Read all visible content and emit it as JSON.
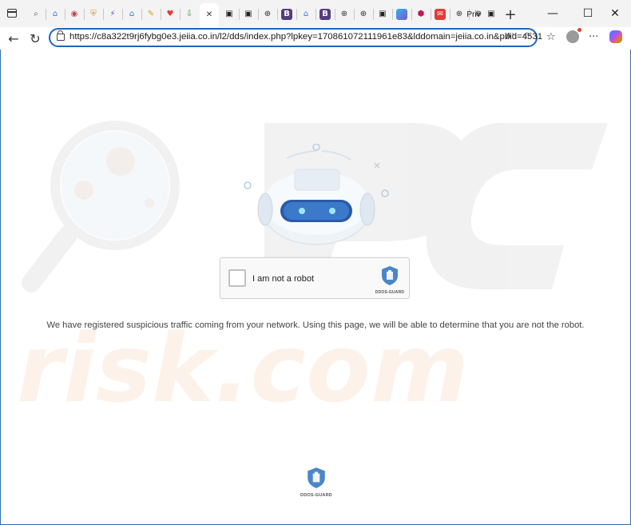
{
  "browser": {
    "tabs": [
      {
        "icon": "magnifier-icon",
        "color": "#555555",
        "active": false
      },
      {
        "icon": "house-icon",
        "color": "#3b7bd6",
        "active": false
      },
      {
        "icon": "target-icon",
        "color": "#d23b3b",
        "active": false
      },
      {
        "icon": "shield-icon",
        "color": "#c79a2a",
        "active": false
      },
      {
        "icon": "bolt-icon",
        "color": "#7b3fe4",
        "active": false
      },
      {
        "icon": "house-icon",
        "color": "#3b7bd6",
        "active": false
      },
      {
        "icon": "tag-icon",
        "color": "#d4a017",
        "active": false
      },
      {
        "icon": "heart-icon",
        "color": "#e03a3a",
        "active": false
      },
      {
        "icon": "download-icon",
        "color": "#2e9a4a",
        "active": false
      },
      {
        "icon": "close-icon",
        "color": "#333333",
        "active": true
      },
      {
        "icon": "page-icon",
        "color": "#222222",
        "active": false
      },
      {
        "icon": "page-icon",
        "color": "#222222",
        "active": false
      },
      {
        "icon": "globe-icon",
        "color": "#333333",
        "active": false
      },
      {
        "icon": "bootstrap-icon",
        "color": "#563d7c",
        "active": false
      },
      {
        "icon": "house-icon",
        "color": "#3b7bd6",
        "active": false
      },
      {
        "icon": "bootstrap-icon",
        "color": "#563d7c",
        "active": false
      },
      {
        "icon": "globe-icon",
        "color": "#333333",
        "active": false
      },
      {
        "icon": "globe-icon",
        "color": "#333333",
        "active": false
      },
      {
        "icon": "page-icon",
        "color": "#222222",
        "active": false
      },
      {
        "icon": "image-icon",
        "color": "#1e88e5",
        "active": false
      },
      {
        "icon": "hexagon-icon",
        "color": "#c2185b",
        "active": false
      },
      {
        "icon": "mail-icon",
        "color": "#e53935",
        "active": false
      },
      {
        "icon": "globe-icon",
        "color": "#333333",
        "active": false
      },
      {
        "icon": "globe-icon",
        "color": "#333333",
        "active": false
      }
    ],
    "last_tab_label": "Priv",
    "new_tab_symbol": "+",
    "window_controls": {
      "minimize": "—",
      "maximize": "☐",
      "close": "✕"
    },
    "nav": {
      "back": "←",
      "refresh": "↻"
    },
    "address": {
      "url": "https://c8a322t9rj6fybg0e3.jeiia.co.in/l2/dds/index.php?lpkey=170861072111961e83&lddomain=jeiia.co.in&pbid=4531"
    },
    "toolbar_icons": {
      "read_aloud": "A",
      "favorite": "☆",
      "favorites": "☆",
      "more": "···"
    }
  },
  "page": {
    "captcha_label": "I am not a robot",
    "brand_text": "DDOS-GUARD",
    "message": "We have registered suspicious traffic coming from your network. Using this page, we will be able to determine that you are not the robot.",
    "bottom_brand_text": "DDOS-GUARD",
    "accent": "#4a86c8"
  }
}
